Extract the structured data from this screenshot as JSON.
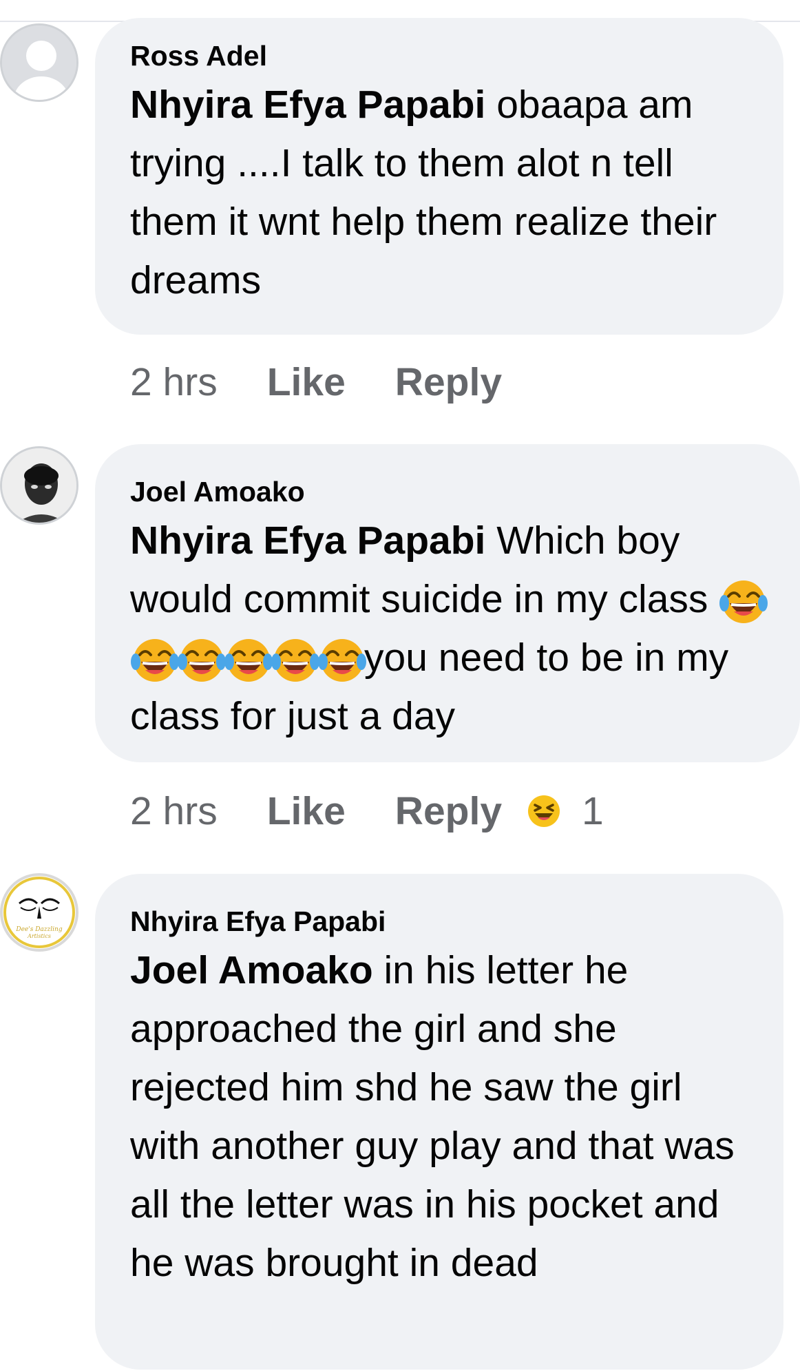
{
  "comments": [
    {
      "author": "Ross Adel",
      "mention": "Nhyira Efya Papabi",
      "text": " obaapa am trying ....I talk to them alot n tell them it wnt help them realize their dreams",
      "time": "2 hrs",
      "like": "Like",
      "reply": "Reply",
      "avatar_icon": "default-profile-icon"
    },
    {
      "author": "Joel Amoako",
      "mention": "Nhyira Efya Papabi",
      "text_before": "  Which boy would commit suicide in my class ",
      "emoji_count": 6,
      "emoji_name": "tears-of-joy-emoji",
      "text_after": "you need to be in my class for just a day",
      "time": "2 hrs",
      "like": "Like",
      "reply": "Reply",
      "reaction_icon": "haha-reaction-icon",
      "reaction_count": "1",
      "avatar_icon": "profile-photo"
    },
    {
      "author": "Nhyira Efya Papabi",
      "mention": "Joel Amoako",
      "text": " in his letter he approached the girl and she rejected him shd he saw the girl with another guy play and that was all the letter was in his pocket and he was brought in dead",
      "avatar_icon": "logo-avatar",
      "avatar_logo_text": "Dee's Dazzling Artistics"
    }
  ],
  "colors": {
    "bubble": "#f0f2f5",
    "meta": "#65676b",
    "text": "#050505",
    "emoji": "#f7c21b"
  }
}
